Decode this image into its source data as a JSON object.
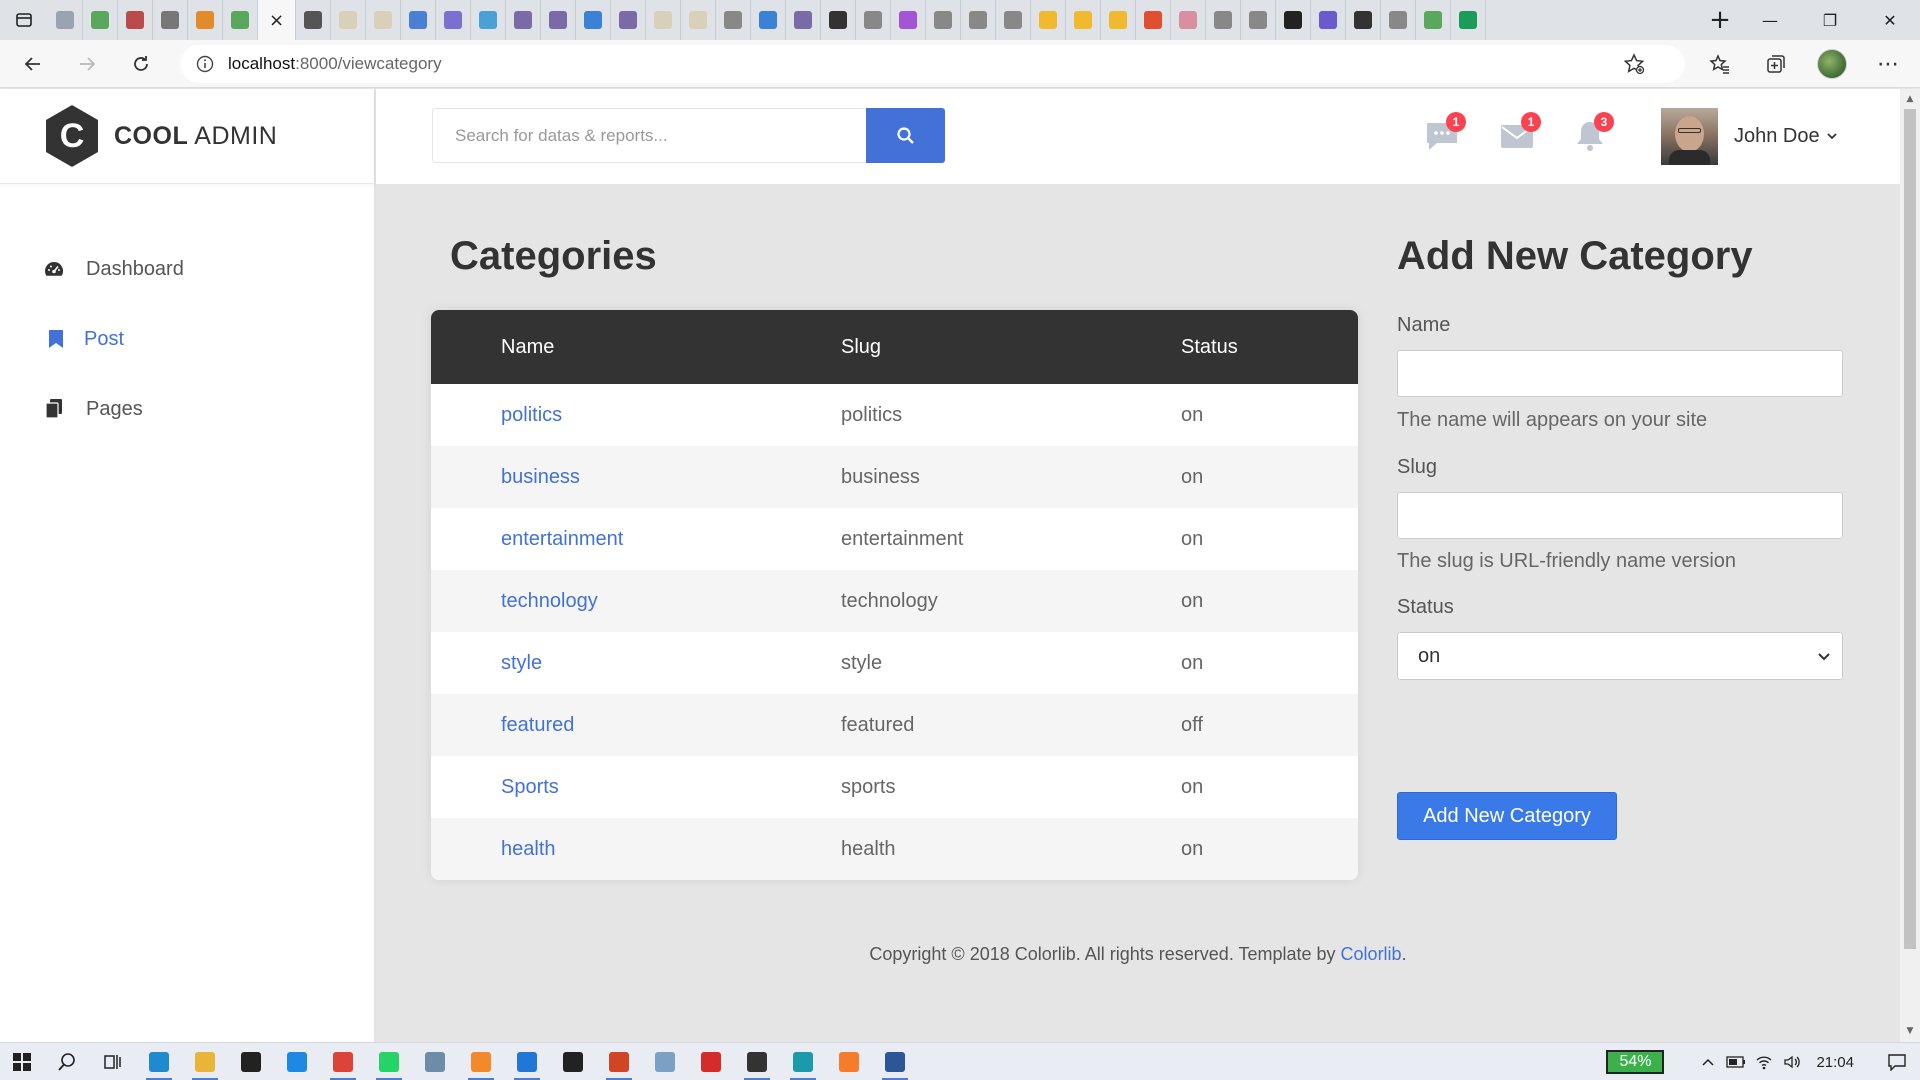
{
  "browser": {
    "tab_count_icons": 41,
    "active_tab_close": "×",
    "new_tab": "+",
    "address": {
      "host": "localhost",
      "path": ":8000/viewcategory"
    },
    "window_controls": {
      "minimize": "—",
      "maximize": "❐",
      "close": "✕"
    }
  },
  "app": {
    "logo": {
      "bold": "COOL",
      "light": " ADMIN",
      "mark": "C"
    },
    "sidebar": {
      "items": [
        {
          "label": "Dashboard",
          "icon": "dashboard-icon",
          "active": false
        },
        {
          "label": "Post",
          "icon": "bookmark-icon",
          "active": true
        },
        {
          "label": "Pages",
          "icon": "copy-icon",
          "active": false
        }
      ]
    },
    "topbar": {
      "search_placeholder": "Search for datas & reports...",
      "badges": {
        "messages": "1",
        "mail": "1",
        "notifications": "3"
      },
      "user_name": "John Doe"
    },
    "categories": {
      "title": "Categories",
      "columns": [
        "Name",
        "Slug",
        "Status"
      ],
      "rows": [
        {
          "name": "politics",
          "slug": "politics",
          "status": "on"
        },
        {
          "name": "business",
          "slug": "business",
          "status": "on"
        },
        {
          "name": "entertainment",
          "slug": "entertainment",
          "status": "on"
        },
        {
          "name": "technology",
          "slug": "technology",
          "status": "on"
        },
        {
          "name": "style",
          "slug": "style",
          "status": "on"
        },
        {
          "name": "featured",
          "slug": "featured",
          "status": "off"
        },
        {
          "name": "Sports",
          "slug": "sports",
          "status": "on"
        },
        {
          "name": "health",
          "slug": "health",
          "status": "on"
        }
      ]
    },
    "form": {
      "title": "Add New Category",
      "name_label": "Name",
      "name_value": "",
      "name_help": "The name will appears on your site",
      "slug_label": "Slug",
      "slug_value": "",
      "slug_help": "The slug is URL-friendly name version",
      "status_label": "Status",
      "status_value": "on",
      "submit_label": "Add New Category"
    },
    "footer": {
      "text": "Copyright © 2018 Colorlib. All rights reserved. Template by ",
      "link": "Colorlib",
      "end": "."
    },
    "colors": {
      "accent": "#4272d7",
      "table_header": "#333333",
      "badge": "#fa4251"
    }
  },
  "taskbar": {
    "battery": "54%",
    "time": "21:04"
  }
}
